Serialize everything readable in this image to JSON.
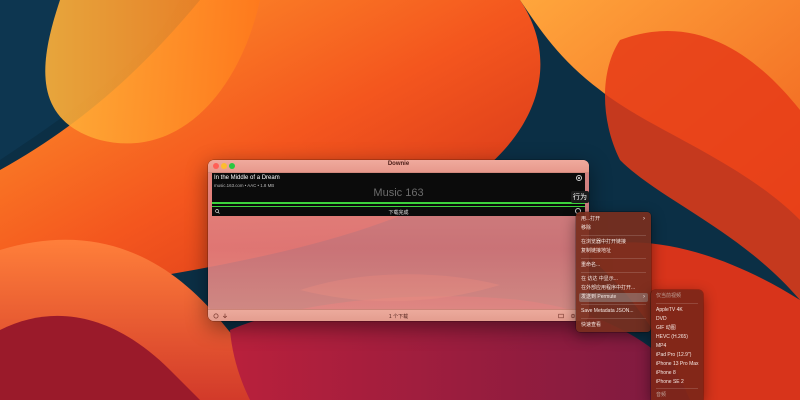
{
  "window": {
    "title": "Downie",
    "item": {
      "title": "In the Middle of a Dream",
      "meta": "music.163.com • AAC • 1.8 MB",
      "site": "Music 163",
      "progress": 1.0
    },
    "status": "下载完成",
    "footer_count": "1 个下载",
    "tooltip": "行为"
  },
  "context_menu": {
    "items": [
      {
        "label": "用...打开",
        "submenu": true
      },
      {
        "label": "移除"
      },
      {
        "label": "在浏览器中打开链接"
      },
      {
        "label": "复制链接地址"
      },
      {
        "label": "重命名..."
      },
      {
        "label": "在 访达 中显示..."
      },
      {
        "label": "在外部应用程序中打开..."
      },
      {
        "label": "发送到 Permute",
        "submenu": true,
        "active": true
      },
      {
        "label": "Save Metadata JSON..."
      },
      {
        "label": "快速查看"
      }
    ]
  },
  "submenu": {
    "header": "仅当前视频",
    "items": [
      "AppleTV 4K",
      "DVD",
      "GIF 动图",
      "HEVC (H.265)",
      "MP4",
      "iPad Pro (12.9\")",
      "iPhone 13 Pro Max",
      "iPhone 8",
      "iPhone SE 2"
    ],
    "footer": "音频"
  },
  "colors": {
    "progress": "#3cd23c",
    "menu_bg": "#782e1e",
    "wallpaper_dark": "#0b2f45"
  }
}
